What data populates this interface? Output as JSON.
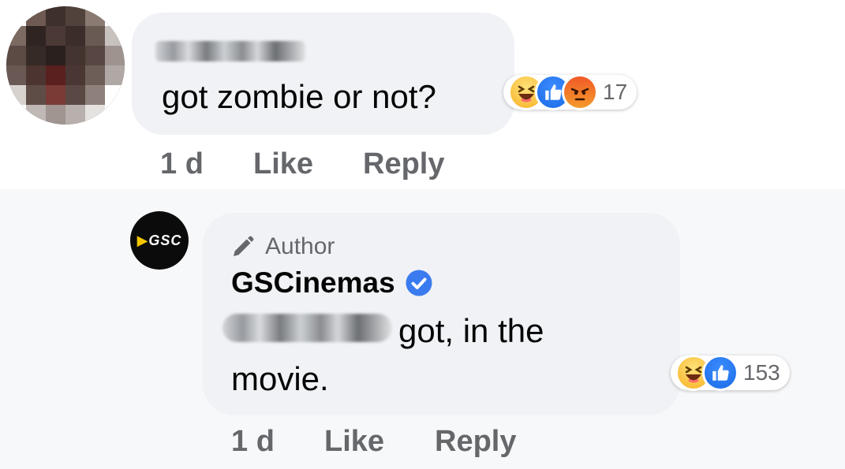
{
  "comment": {
    "text": "got zombie or not?",
    "reactions": {
      "icons": [
        "haha-icon",
        "like-icon",
        "angry-icon"
      ],
      "count": "17"
    },
    "time": "1 d",
    "like_label": "Like",
    "reply_label": "Reply"
  },
  "reply": {
    "author_badge": "Author",
    "name": "GSCinemas",
    "text_line1": "got, in the",
    "text_line2": "movie.",
    "reactions": {
      "icons": [
        "haha-icon",
        "like-icon"
      ],
      "count": "153"
    },
    "time": "1 d",
    "like_label": "Like",
    "reply_label": "Reply"
  },
  "colors": {
    "bubble": "#f0f2f5",
    "meta_text": "#65676b",
    "verified_blue": "#1877f2",
    "like_blue": "#1b6ae6"
  }
}
